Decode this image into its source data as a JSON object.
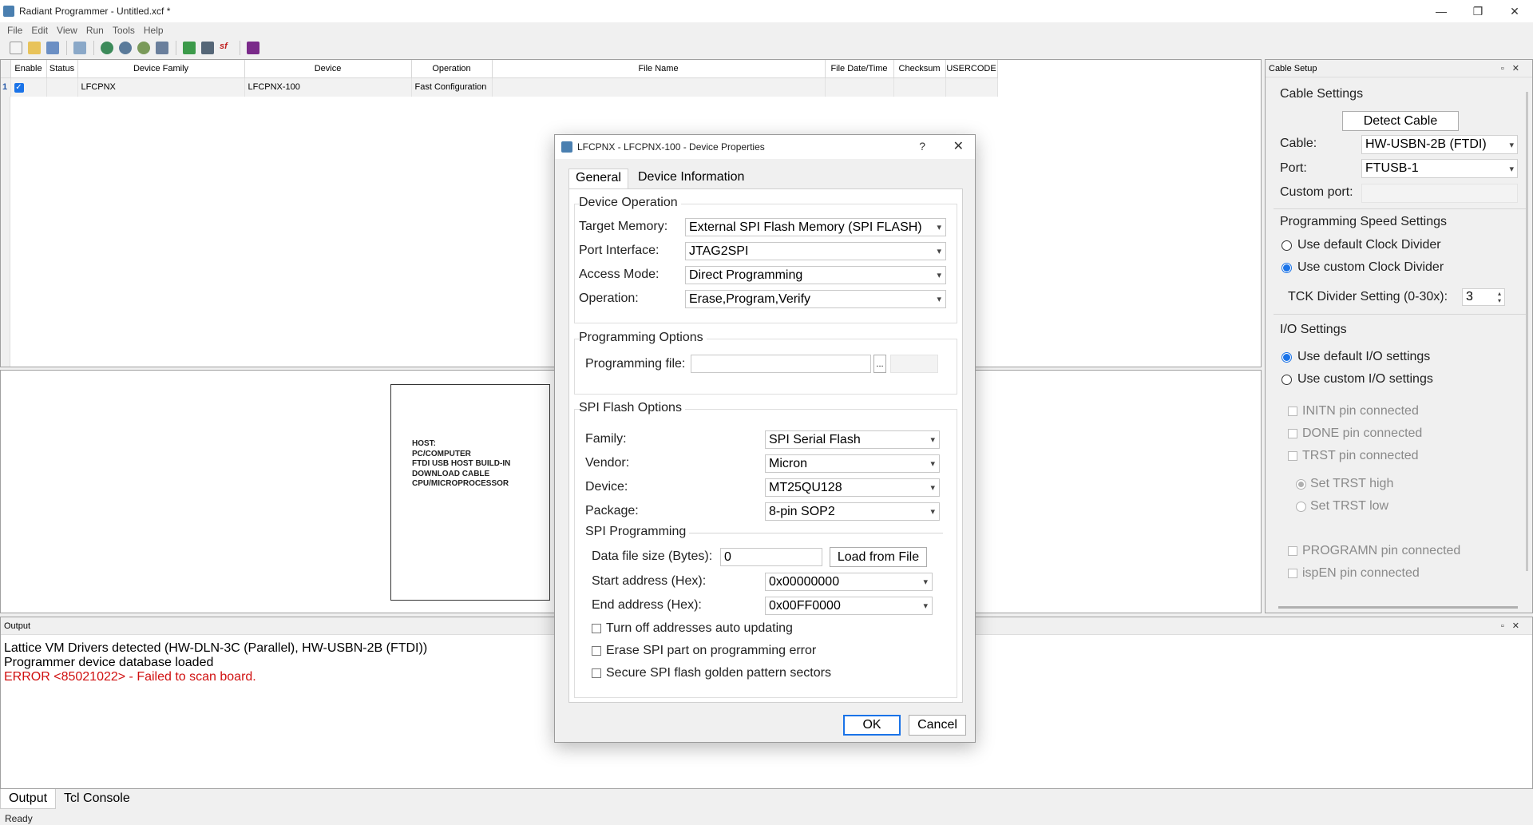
{
  "window": {
    "title": "Radiant Programmer - Untitled.xcf *",
    "controls": [
      "—",
      "❐",
      "✕"
    ]
  },
  "menu": [
    "File",
    "Edit",
    "View",
    "Run",
    "Tools",
    "Help"
  ],
  "toolbar": {
    "buttons": [
      "new-icon",
      "open-icon",
      "save-icon",
      "scan-icon",
      "program-icon",
      "program-all-icon",
      "settings-icon",
      "detect-icon",
      "download-icon",
      "export-icon",
      "spi-flash-icon",
      "log-icon"
    ]
  },
  "device_table": {
    "columns": [
      "Enable",
      "Status",
      "Device Family",
      "Device",
      "Operation",
      "File Name",
      "File Date/Time",
      "Checksum",
      "USERCODE"
    ],
    "rows": [
      {
        "num": "1",
        "enabled": true,
        "status": "",
        "family": "LFCPNX",
        "device": "LFCPNX-100",
        "operation": "Fast Configuration",
        "file": "",
        "date": "",
        "checksum": "",
        "usercode": ""
      }
    ]
  },
  "diagram": {
    "lines": [
      "HOST:",
      "PC/COMPUTER",
      "FTDI USB HOST BUILD-IN",
      "DOWNLOAD CABLE",
      "CPU/MICROPROCESSOR"
    ]
  },
  "cable_setup": {
    "header": "Cable Setup",
    "cable_settings": "Cable Settings",
    "detect_cable": "Detect Cable",
    "cable_label": "Cable:",
    "cable_value": "HW-USBN-2B (FTDI)",
    "port_label": "Port:",
    "port_value": "FTUSB-1",
    "custom_port_label": "Custom port:",
    "speed_settings": "Programming Speed Settings",
    "use_default_divider": "Use default Clock Divider",
    "use_custom_divider": "Use custom Clock Divider",
    "tck_label": "TCK Divider Setting (0-30x):",
    "tck_value": "3",
    "io_settings": "I/O Settings",
    "use_default_io": "Use default I/O settings",
    "use_custom_io": "Use custom I/O settings",
    "initn": "INITN pin connected",
    "done": "DONE pin connected",
    "trst": "TRST pin connected",
    "trst_high": "Set TRST high",
    "trst_low": "Set TRST low",
    "programn": "PROGRAMN pin connected",
    "ispen": "ispEN pin connected"
  },
  "output": {
    "header": "Output",
    "lines": [
      {
        "text": "Lattice VM Drivers detected (HW-DLN-3C (Parallel), HW-USBN-2B (FTDI))",
        "error": false
      },
      {
        "text": "Programmer device database loaded",
        "error": false
      },
      {
        "text": "ERROR <85021022> - Failed to scan board.",
        "error": true
      }
    ],
    "error_color": "#d01010"
  },
  "bottom_tabs": [
    "Output",
    "Tcl Console"
  ],
  "status": "Ready",
  "dialog": {
    "title": "LFCPNX - LFCPNX-100 - Device Properties",
    "help": "?",
    "close": "✕",
    "tabs": [
      "General",
      "Device Information"
    ],
    "device_operation": "Device Operation",
    "target_memory_label": "Target Memory:",
    "target_memory_value": "External SPI Flash Memory (SPI FLASH)",
    "port_interface_label": "Port Interface:",
    "port_interface_value": "JTAG2SPI",
    "access_mode_label": "Access Mode:",
    "access_mode_value": "Direct Programming",
    "operation_label": "Operation:",
    "operation_value": "Erase,Program,Verify",
    "programming_options": "Programming Options",
    "programming_file_label": "Programming file:",
    "programming_file_value": "",
    "browse": "...",
    "spi_flash_options": "SPI Flash Options",
    "family_label": "Family:",
    "family_value": "SPI Serial Flash",
    "vendor_label": "Vendor:",
    "vendor_value": "Micron",
    "device_label": "Device:",
    "device_value": "MT25QU128",
    "package_label": "Package:",
    "package_value": "8-pin SOP2",
    "spi_programming": "SPI Programming",
    "data_size_label": "Data file size (Bytes):",
    "data_size_value": "0",
    "load_from_file": "Load from File",
    "start_addr_label": "Start address (Hex):",
    "start_addr_value": "0x00000000",
    "end_addr_label": "End address (Hex):",
    "end_addr_value": "0x00FF0000",
    "turn_off_auto": "Turn off addresses auto updating",
    "erase_spi": "Erase SPI part on programming error",
    "secure_spi": "Secure SPI flash golden pattern sectors",
    "ok": "OK",
    "cancel": "Cancel"
  },
  "colors": {
    "accent": "#1a73e8",
    "error": "#d01010"
  }
}
